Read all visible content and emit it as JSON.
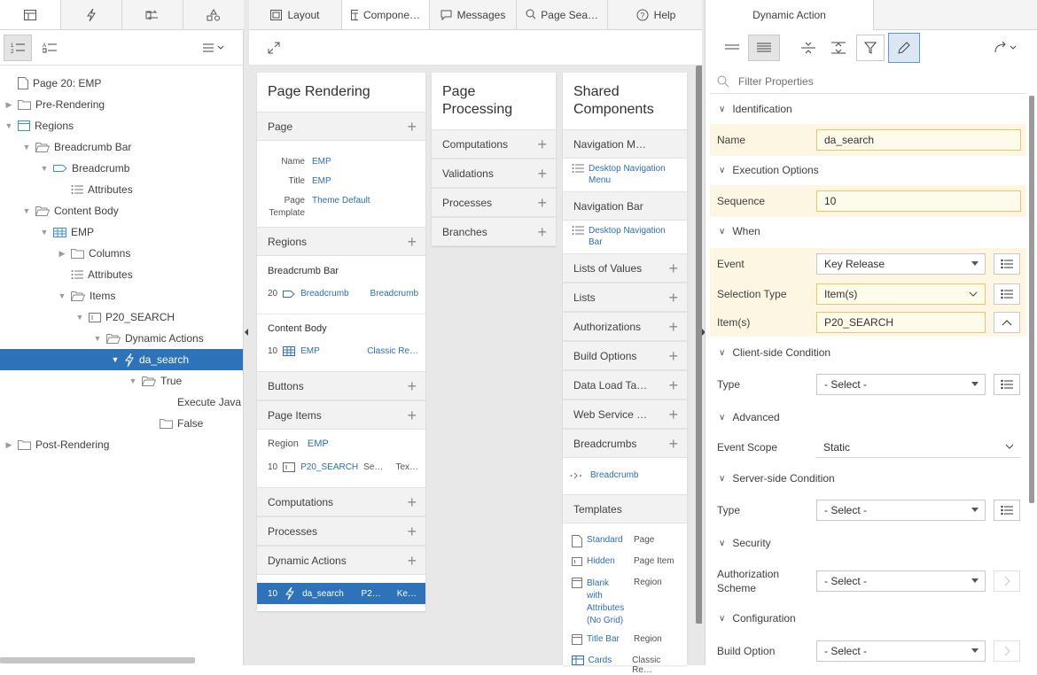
{
  "left": {
    "tabs": [
      "rendering-tab",
      "dynamic-actions-tab",
      "processing-tab",
      "shared-components-tab"
    ],
    "tree": [
      {
        "label": "Page 20: EMP",
        "icon": "page",
        "level": 0,
        "toggle": ""
      },
      {
        "label": "Pre-Rendering",
        "icon": "folder",
        "level": 0,
        "toggle": "closed"
      },
      {
        "label": "Regions",
        "icon": "region",
        "level": 0,
        "toggle": "open"
      },
      {
        "label": "Breadcrumb Bar",
        "icon": "folder-open",
        "level": 1,
        "toggle": "open"
      },
      {
        "label": "Breadcrumb",
        "icon": "breadcrumb",
        "level": 2,
        "toggle": "open"
      },
      {
        "label": "Attributes",
        "icon": "list",
        "level": 3,
        "toggle": ""
      },
      {
        "label": "Content Body",
        "icon": "folder-open",
        "level": 1,
        "toggle": "open"
      },
      {
        "label": "EMP",
        "icon": "grid",
        "level": 2,
        "toggle": "open"
      },
      {
        "label": "Columns",
        "icon": "folder",
        "level": 3,
        "toggle": "closed"
      },
      {
        "label": "Attributes",
        "icon": "list",
        "level": 3,
        "toggle": ""
      },
      {
        "label": "Items",
        "icon": "folder-open",
        "level": 3,
        "toggle": "open"
      },
      {
        "label": "P20_SEARCH",
        "icon": "item",
        "level": 4,
        "toggle": "open"
      },
      {
        "label": "Dynamic Actions",
        "icon": "folder-open",
        "level": 5,
        "toggle": "open"
      },
      {
        "label": "da_search",
        "icon": "bolt",
        "level": 6,
        "toggle": "open"
      },
      {
        "label": "True",
        "icon": "folder-open",
        "level": 7,
        "toggle": "open"
      },
      {
        "label": "Execute Java",
        "icon": "none",
        "level": 9,
        "toggle": ""
      },
      {
        "label": "False",
        "icon": "folder",
        "level": 8,
        "toggle": ""
      },
      {
        "label": "Post-Rendering",
        "icon": "folder",
        "level": 0,
        "toggle": "closed"
      }
    ]
  },
  "mid": {
    "tabs": [
      {
        "label": "Layout",
        "icon": "layout"
      },
      {
        "label": "Compone…",
        "icon": "component"
      },
      {
        "label": "Messages",
        "icon": "message"
      },
      {
        "label": "Page Sea…",
        "icon": "search"
      },
      {
        "label": "Help",
        "icon": "help"
      }
    ],
    "rendering": {
      "title": "Page Rendering",
      "page_section": "Page",
      "page_props": [
        {
          "k": "Name",
          "v": "EMP"
        },
        {
          "k": "Title",
          "v": "EMP"
        },
        {
          "k": "Page",
          "k2": "Template",
          "v": "Theme Default"
        }
      ],
      "regions_section": "Regions",
      "breadcrumb_bar": {
        "title": "Breadcrumb Bar",
        "seq": "20",
        "name": "Breadcrumb",
        "type": "Breadcrumb"
      },
      "content_body": {
        "title": "Content Body",
        "seq": "10",
        "name": "EMP",
        "type": "Classic Re…"
      },
      "buttons": "Buttons",
      "page_items": "Page Items",
      "region_label": "Region",
      "region_value": "EMP",
      "item": {
        "seq": "10",
        "name": "P20_SEARCH",
        "col3": "Se…",
        "col4": "Tex…"
      },
      "computations": "Computations",
      "processes": "Processes",
      "dynamic_actions": "Dynamic Actions",
      "da_row": {
        "seq": "10",
        "name": "da_search",
        "col3": "P2…",
        "col4": "Ke…"
      }
    },
    "processing": {
      "title_line1": "Page",
      "title_line2": "Processing",
      "sections": [
        "Computations",
        "Validations",
        "Processes",
        "Branches"
      ]
    },
    "shared": {
      "title_line1": "Shared",
      "title_line2": "Components",
      "nav_menu": "Navigation M…",
      "nav_menu_item_1": "Desktop Navigation",
      "nav_menu_item_2": "Menu",
      "nav_bar": "Navigation Bar",
      "nav_bar_item_1": "Desktop Navigation",
      "nav_bar_item_2": "Bar",
      "sections": [
        "Lists of Values",
        "Lists",
        "Authorizations",
        "Build Options",
        "Data Load Ta…",
        "Web Service …",
        "Breadcrumbs"
      ],
      "breadcrumb_item": "Breadcrumb",
      "templates": "Templates",
      "template_rows": [
        {
          "icon": "page",
          "name": "Standard",
          "type": "Page"
        },
        {
          "icon": "item",
          "name": "Hidden",
          "type": "Page Item"
        },
        {
          "icon": "region",
          "name": "Blank",
          "name2": "with",
          "name3": "Attributes",
          "name4": "(No Grid)",
          "type": "Region"
        },
        {
          "icon": "region",
          "name": "Title Bar",
          "type": "Region"
        },
        {
          "icon": "grid",
          "name": "Cards",
          "type": "Classic Re…"
        }
      ]
    }
  },
  "right": {
    "tab": "Dynamic Action",
    "filter_placeholder": "Filter Properties",
    "groups": {
      "identification": "Identification",
      "execution": "Execution Options",
      "when": "When",
      "client": "Client-side Condition",
      "advanced": "Advanced",
      "server": "Server-side Condition",
      "security": "Security",
      "configuration": "Configuration"
    },
    "props": {
      "name_label": "Name",
      "name_value": "da_search",
      "sequence_label": "Sequence",
      "sequence_value": "10",
      "event_label": "Event",
      "event_value": "Key Release",
      "seltype_label": "Selection Type",
      "seltype_value": "Item(s)",
      "items_label": "Item(s)",
      "items_value": "P20_SEARCH",
      "client_type_label": "Type",
      "client_type_value": "- Select -",
      "scope_label": "Event Scope",
      "scope_value": "Static",
      "server_type_label": "Type",
      "server_type_value": "- Select -",
      "auth_label_1": "Authorization",
      "auth_label_2": "Scheme",
      "auth_value": "- Select -",
      "build_label": "Build Option",
      "build_value": "- Select -"
    }
  }
}
